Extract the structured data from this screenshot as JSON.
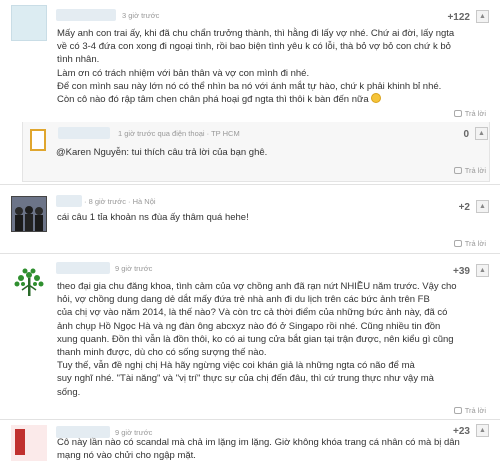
{
  "comments": [
    {
      "time": "3 giờ trước",
      "score": "+122",
      "lines": [
        "Mấy anh con trai ấy, khi đã chu chẩn trưởng thành, thì hằng đi lấy vợ nhé. Chứ ai đời, lấy ngta",
        "về có 3-4 đứa con xong đi ngoại tình, rồi bao biện tình yêu k có lỗi, thà bỏ vợ bỏ con chứ k bỏ",
        "tình nhân.",
        "Làm ơn có trách nhiệm với bản thân và vợ con mình đi nhé.",
        "Để con mình sau này lớn nó có thể nhìn ba nó với ánh mắt tự hào, chứ k phải khinh bỉ nhé.",
        "Còn cô nào đó rập tâm chen chân phá hoại gđ ngta thì thôi k bàn đến nữa"
      ],
      "reply_label": "Trả lời"
    },
    {
      "time": "1 giờ trước qua điện thoại · TP HCM",
      "score": "0",
      "lines": [
        "@Karen Nguyễn: tui thích câu trả lời của bạn ghê."
      ],
      "reply_label": "Trả lời"
    },
    {
      "time": "· 8 giờ trước · Hà Nội",
      "score": "+2",
      "lines": [
        "cái câu 1 tỉa khoản ns đùa ấy thâm quá hehe!"
      ],
      "reply_label": "Trả lời"
    },
    {
      "time": "9 giờ trước",
      "score": "+39",
      "lines": [
        "theo đại gia chu đăng khoa, tình cảm của vợ chồng anh đã rạn nứt NHIỀU năm trước. Vậy cho",
        "hỏi, vợ chồng dung dang dẻ dắt mấy đứa trẻ nhà anh đi du lịch trên các bức ảnh trên FB",
        "của chị vợ vào năm 2014, là thế nào? Và còn trc cả thời điểm của những bức ảnh này, đã có",
        "ảnh chụp Hồ Ngọc Hà và ng đàn ông abcxyz nào đó ở Singapo rồi nhé. Cũng nhiều tin đồn",
        "xung quanh. Đồn thì vẫn là đồn thôi, ko có ai tung cửa bắt gian tại trận được, nên kiểu gì cũng",
        "thanh minh được, dù cho có sống sượng thế nào.",
        "Tuy thế, vẫn đề nghị chị Hà hãy ngừng việc coi khán giả là những ngta có não để mà",
        "suy nghĩ nhé. \"Tài năng\" và \"vị trí\" thực sự của chị đến đâu, thì cứ trung thực như vậy mà",
        "sống."
      ],
      "reply_label": "Trả lời"
    },
    {
      "time": "9 giờ trước",
      "score": "+23",
      "lines": [
        "Cô này lần nào có scandal mà chả im lặng im lặng. Giờ không khóa trang cá nhân có mà bị dân",
        "mạng nó vào chửi cho ngập mặt."
      ]
    }
  ],
  "colors": {
    "emoji": "#f5c43a",
    "avatar_green": "#2f8f2f",
    "avatar_red": "#c0312f",
    "border": "#e2e2e2"
  }
}
